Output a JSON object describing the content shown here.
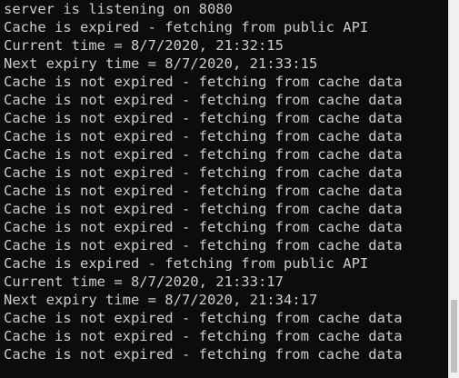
{
  "console": {
    "lines": [
      "server is listening on 8080",
      "Cache is expired - fetching from public API",
      "Current time = 8/7/2020, 21:32:15",
      "Next expiry time = 8/7/2020, 21:33:15",
      "Cache is not expired - fetching from cache data",
      "Cache is not expired - fetching from cache data",
      "Cache is not expired - fetching from cache data",
      "Cache is not expired - fetching from cache data",
      "Cache is not expired - fetching from cache data",
      "Cache is not expired - fetching from cache data",
      "Cache is not expired - fetching from cache data",
      "Cache is not expired - fetching from cache data",
      "Cache is not expired - fetching from cache data",
      "Cache is not expired - fetching from cache data",
      "Cache is expired - fetching from public API",
      "Current time = 8/7/2020, 21:33:17",
      "Next expiry time = 8/7/2020, 21:34:17",
      "Cache is not expired - fetching from cache data",
      "Cache is not expired - fetching from cache data",
      "Cache is not expired - fetching from cache data"
    ]
  },
  "colors": {
    "background": "#0c0c0c",
    "text": "#cccccc",
    "scrollbar_track": "#f0f0f0",
    "scrollbar_thumb": "#c1c1c1"
  }
}
